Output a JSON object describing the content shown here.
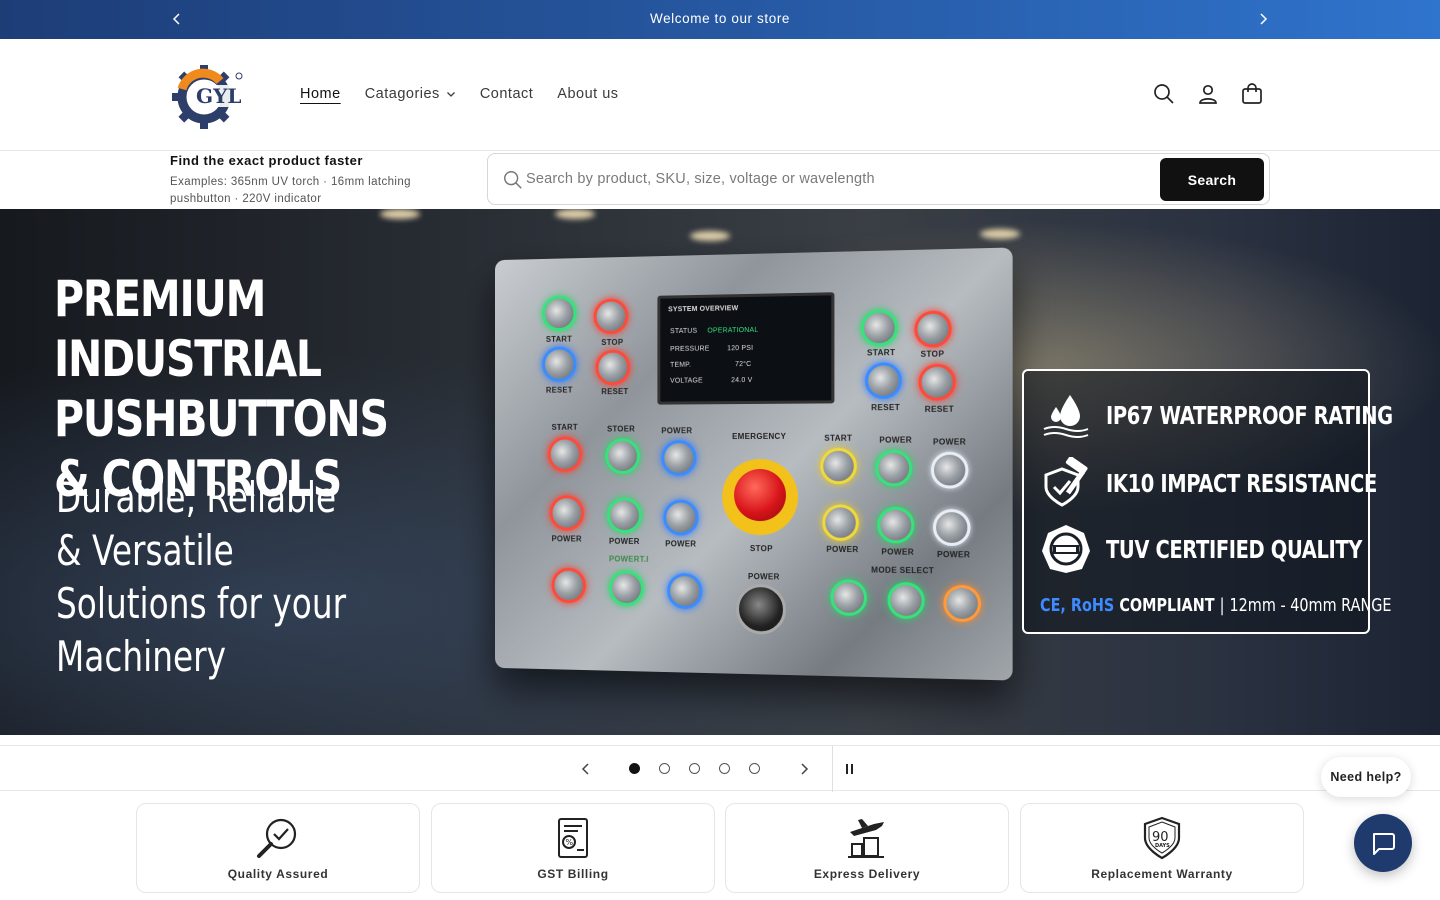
{
  "announcement": {
    "message": "Welcome to our store"
  },
  "brand": {
    "logo_text": "GYL"
  },
  "nav": {
    "items": [
      {
        "label": "Home",
        "active": true
      },
      {
        "label": "Catagories",
        "dropdown": true
      },
      {
        "label": "Contact"
      },
      {
        "label": "About us"
      }
    ]
  },
  "header_icons": [
    "search-icon",
    "account-icon",
    "cart-icon"
  ],
  "search": {
    "helper_title": "Find the exact product faster",
    "helper_text": "Examples: 365nm UV torch · 16mm latching pushbutton · 220V indicator",
    "placeholder": "Search by product, SKU, size, voltage or wavelength",
    "button_label": "Search"
  },
  "hero": {
    "headline_1": "PREMIUM INDUSTRIAL",
    "headline_2": "PUSHBUTTONS",
    "headline_3": "& CONTROLS",
    "sub_1": "Durable, Reliable",
    "sub_2": "& Versatile",
    "sub_3": "Solutions for your",
    "sub_4": "Machinery",
    "panel": {
      "screen_title": "SYSTEM OVERVIEW",
      "status_label": "STATUS",
      "status_value": "OPERATIONAL",
      "pressure_label": "PRESSURE",
      "pressure_value": "120 PSI",
      "temp_label": "TEMP.",
      "temp_value": "72°C",
      "voltage_label": "VOLTAGE",
      "voltage_value": "24.0 V",
      "labels": {
        "start": "START",
        "stop": "STOP",
        "reset": "RESET",
        "stoer": "STOER",
        "power": "POWER",
        "emergency": "EMERGENCY",
        "mode_select": "MODE SELECT",
        "powert": "POWERT.I"
      }
    },
    "features": [
      {
        "icon": "water-drop-icon",
        "text": "IP67 WATERPROOF RATING"
      },
      {
        "icon": "hammer-shield-icon",
        "text": "IK10 IMPACT RESISTANCE"
      },
      {
        "icon": "tuv-seal-icon",
        "text": "TUV CERTIFIED QUALITY"
      }
    ],
    "compliance_highlight": "CE, RoHS",
    "compliance_word": "COMPLIANT",
    "compliance_sep": "|",
    "compliance_range": "12mm - 40mm RANGE"
  },
  "slider": {
    "slide_count": 5,
    "active_index": 0
  },
  "trust_badges": [
    {
      "icon": "quality-check-icon",
      "label": "Quality Assured"
    },
    {
      "icon": "gst-bill-icon",
      "label": "GST Billing"
    },
    {
      "icon": "express-delivery-icon",
      "label": "Express Delivery"
    },
    {
      "icon": "warranty-shield-icon",
      "label": "Replacement Warranty",
      "icon_text": "90",
      "icon_subtext": "DAYS"
    }
  ],
  "chat": {
    "help_label": "Need help?"
  },
  "colors": {
    "announce_start": "#1d3d77",
    "announce_end": "#2f74cd",
    "accent_blue": "#3d8bff",
    "chat_bg": "#1f3b6e",
    "button_dark": "#111111"
  }
}
